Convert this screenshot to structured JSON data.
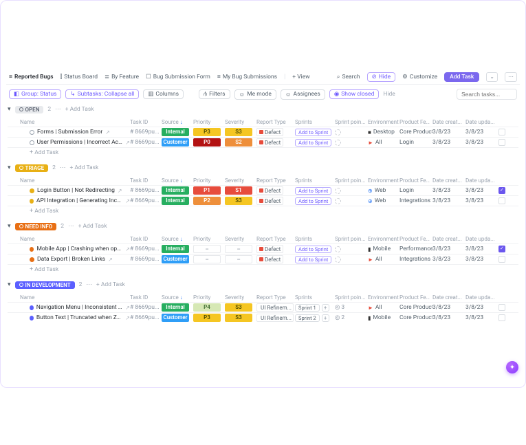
{
  "top": {
    "tabs": [
      {
        "icon": "≡",
        "label": "Reported Bugs"
      },
      {
        "icon": "⫿",
        "label": "Status Board"
      },
      {
        "icon": "≣",
        "label": "By Feature"
      },
      {
        "icon": "☐",
        "label": "Bug Submission Form"
      },
      {
        "icon": "≡",
        "label": "My Bug Submissions"
      }
    ],
    "add_view": "+ View",
    "search": "Search",
    "hide": "Hide",
    "customize": "Customize",
    "add_task": "Add Task"
  },
  "filters": {
    "group": "Group: Status",
    "subtasks": "Subtasks: Collapse all",
    "columns": "Columns",
    "filters": "Filters",
    "me": "Me mode",
    "assignees": "Assignees",
    "show_closed": "Show closed",
    "hide": "Hide",
    "search_placeholder": "Search tasks..."
  },
  "columns": [
    "Name",
    "Task ID",
    "Source",
    "Priority",
    "Severity",
    "Report Type",
    "Sprints",
    "Sprint poin...",
    "Environment",
    "Product Feature",
    "Date creat...",
    "Date upda..."
  ],
  "add_task_text": "Add Task",
  "groups": [
    {
      "id": "open",
      "status_label": "OPEN",
      "status_class": "status-open",
      "dot_class": "dot-open",
      "count": "2",
      "rows": [
        {
          "name": "Forms | Submission Error",
          "id": "# 8669pu...",
          "source": "Internal",
          "source_class": "internal",
          "priority": "P3",
          "priority_class": "p3",
          "severity": "S3",
          "severity_class": "s3",
          "report": "Defect",
          "report_class": "red-sq",
          "sprint": "add",
          "sprint_label": "Add to Sprint",
          "points": "circle",
          "env_icon": "■",
          "env_color": "#333",
          "env": "Desktop",
          "feature": "Core Product",
          "created": "3/8/23",
          "updated": "3/8/23",
          "check": false
        },
        {
          "name": "User Permissions | Incorrect Access",
          "id": "# 8669pu...",
          "source": "Customer",
          "source_class": "customer",
          "priority": "P0",
          "priority_class": "p0",
          "severity": "S2",
          "severity_class": "s2",
          "report": "Defect",
          "report_class": "red-sq",
          "sprint": "add",
          "sprint_label": "Add to Sprint",
          "points": "circle",
          "env_icon": "►",
          "env_color": "#e74c3c",
          "env": "All",
          "feature": "Login",
          "created": "3/8/23",
          "updated": "3/8/23",
          "check": false
        }
      ]
    },
    {
      "id": "triage",
      "status_label": "TRIAGE",
      "status_class": "status-triage",
      "dot_class": "dot-triage",
      "count": "2",
      "rows": [
        {
          "name": "Login Button | Not Redirecting",
          "id": "# 8669pu...",
          "source": "Internal",
          "source_class": "internal",
          "priority": "P1",
          "priority_class": "p1",
          "severity": "S1",
          "severity_class": "s1",
          "report": "Defect",
          "report_class": "red-sq",
          "sprint": "add",
          "sprint_label": "Add to Sprint",
          "points": "circle",
          "env_icon": "⊕",
          "env_color": "#3b82f6",
          "env": "Web",
          "feature": "Login",
          "created": "3/8/23",
          "updated": "3/8/23",
          "check": true
        },
        {
          "name": "API Integration | Generating Incorrect ...",
          "id": "# 8669pu...",
          "source": "Internal",
          "source_class": "internal",
          "priority": "P2",
          "priority_class": "p2",
          "severity": "S3",
          "severity_class": "s3",
          "report": "Defect",
          "report_class": "red-sq",
          "sprint": "add",
          "sprint_label": "Add to Sprint",
          "points": "circle",
          "env_icon": "⊕",
          "env_color": "#3b82f6",
          "env": "Web",
          "feature": "Integrations",
          "created": "3/8/23",
          "updated": "3/8/23",
          "check": false
        }
      ]
    },
    {
      "id": "needinfo",
      "status_label": "NEED INFO",
      "status_class": "status-needinfo",
      "dot_class": "dot-needinfo",
      "count": "2",
      "rows": [
        {
          "name": "Mobile App | Crashing when opened",
          "id": "# 8669pu...",
          "source": "Internal",
          "source_class": "internal",
          "priority": "–",
          "priority_class": "blank",
          "severity": "–",
          "severity_class": "blank",
          "report": "Defect",
          "report_class": "red-sq",
          "sprint": "add",
          "sprint_label": "Add to Sprint",
          "points": "circle",
          "env_icon": "▮",
          "env_color": "#333",
          "env": "Mobile",
          "feature": "Performance",
          "created": "3/8/23",
          "updated": "3/8/23",
          "check": true
        },
        {
          "name": "Data Export | Broken Links",
          "id": "# 8669pu...",
          "source": "Customer",
          "source_class": "customer",
          "priority": "–",
          "priority_class": "blank",
          "severity": "–",
          "severity_class": "blank",
          "report": "Defect",
          "report_class": "red-sq",
          "sprint": "add",
          "sprint_label": "Add to Sprint",
          "points": "circle",
          "env_icon": "►",
          "env_color": "#e74c3c",
          "env": "All",
          "feature": "Integrations",
          "created": "3/8/23",
          "updated": "3/8/23",
          "check": false
        }
      ]
    },
    {
      "id": "indev",
      "status_label": "IN DEVELOPMENT",
      "status_class": "status-indev",
      "dot_class": "dot-indev",
      "count": "2",
      "rows": [
        {
          "name": "Navigation Menu | Inconsistent Font Si...",
          "id": "# 8669pu...",
          "source": "Internal",
          "source_class": "internal",
          "priority": "P4",
          "priority_class": "p4",
          "severity": "S3",
          "severity_class": "s3",
          "report": "UI Refinem...",
          "report_class": "brn-sq",
          "sprint": "tag",
          "sprint_label": "Sprint 1",
          "points": "3",
          "env_icon": "►",
          "env_color": "#e74c3c",
          "env": "All",
          "feature": "Core Product",
          "created": "3/8/23",
          "updated": "3/8/23",
          "check": false
        },
        {
          "name": "Button Text | Truncated when Zoomed...",
          "id": "# 8669pu...",
          "source": "Customer",
          "source_class": "customer",
          "priority": "P3",
          "priority_class": "p3",
          "severity": "S3",
          "severity_class": "s3",
          "report": "UI Refinem...",
          "report_class": "brn-sq",
          "sprint": "tag",
          "sprint_label": "Sprint 2",
          "points": "2",
          "env_icon": "▮",
          "env_color": "#333",
          "env": "Mobile",
          "feature": "Core Product",
          "created": "3/8/23",
          "updated": "3/8/23",
          "check": false
        }
      ]
    }
  ]
}
